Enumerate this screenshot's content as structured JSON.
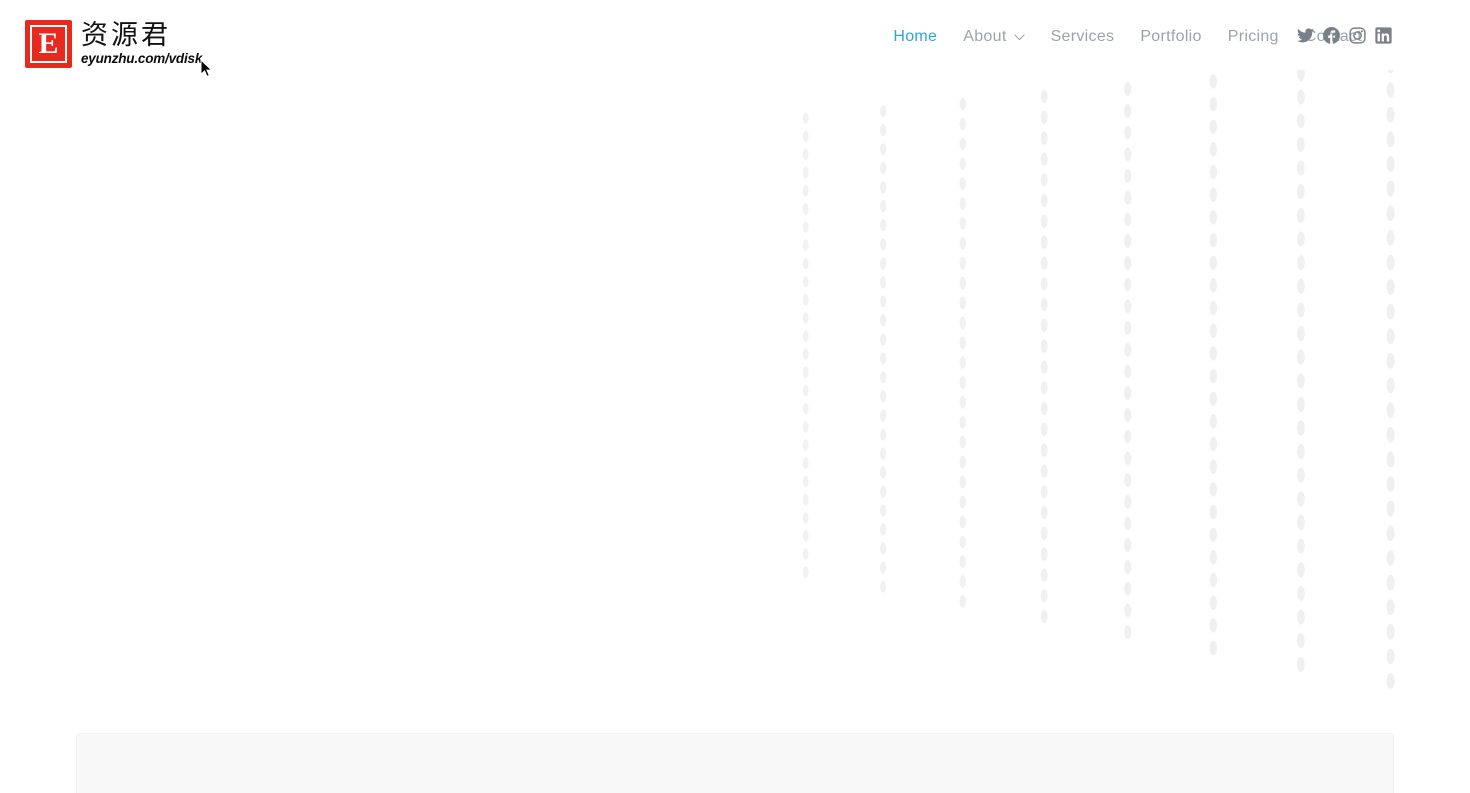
{
  "page": {
    "background_color": "#ffffff",
    "accent_color": "#2fa4e0",
    "brand_color": "#e8291e",
    "nav_color": "#9aa3ac",
    "pattern_dot_color": "#f0f0f1"
  },
  "header": {
    "brand": {
      "mark_letter": "E",
      "mark_bg": "#e8291e",
      "name_cn": "资源君",
      "url": "eyunzhu.com/vdisk"
    },
    "nav": [
      {
        "label": "Home",
        "active": true,
        "has_dropdown": false
      },
      {
        "label": "About",
        "active": false,
        "has_dropdown": true,
        "dropdown_icon": "chevron-down-icon"
      },
      {
        "label": "Services",
        "active": false,
        "has_dropdown": false
      },
      {
        "label": "Portfolio",
        "active": false,
        "has_dropdown": false
      },
      {
        "label": "Pricing",
        "active": false,
        "has_dropdown": false
      },
      {
        "label": "Contact",
        "active": false,
        "has_dropdown": false
      }
    ],
    "social": [
      {
        "name": "twitter-icon",
        "label": "Twitter"
      },
      {
        "name": "facebook-icon",
        "label": "Facebook"
      },
      {
        "name": "instagram-icon",
        "label": "Instagram"
      },
      {
        "name": "linkedin-icon",
        "label": "LinkedIn"
      }
    ]
  },
  "hero": {
    "decoration": "dot-perspective-grid",
    "content_text": ""
  },
  "lower_panel": {
    "background": "#f8f8f9",
    "content_text": ""
  }
}
